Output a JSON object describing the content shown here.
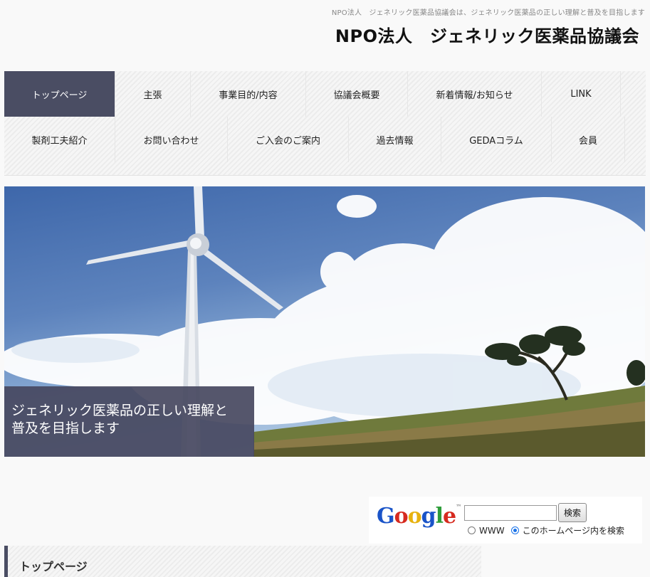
{
  "header": {
    "tagline": "NPO法人　ジェネリック医薬品協議会は、ジェネリック医薬品の正しい理解と普及を目指します",
    "site_title": "NPO法人　ジェネリック医薬品協議会"
  },
  "nav": {
    "row1": [
      "トップページ",
      "主張",
      "事業目的/内容",
      "協議会概要",
      "新着情報/お知らせ",
      "LINK"
    ],
    "row2": [
      "製剤工夫紹介",
      "お問い合わせ",
      "ご入会のご案内",
      "過去情報",
      "GEDAコラム",
      "会員"
    ],
    "active": "トップページ"
  },
  "hero": {
    "caption_line1": "ジェネリック医薬品の正しい理解と",
    "caption_line2": "普及を目指します"
  },
  "search": {
    "logo_text": "Google",
    "logo_tm": "™",
    "input_value": "",
    "button_label": "検索",
    "option_www": "WWW",
    "option_site": "このホームページ内を検索",
    "selected_option": "このホームページ内を検索"
  },
  "section": {
    "title": "トップページ"
  },
  "colors": {
    "accent": "#4a4d63",
    "background": "#f9f9f9"
  }
}
